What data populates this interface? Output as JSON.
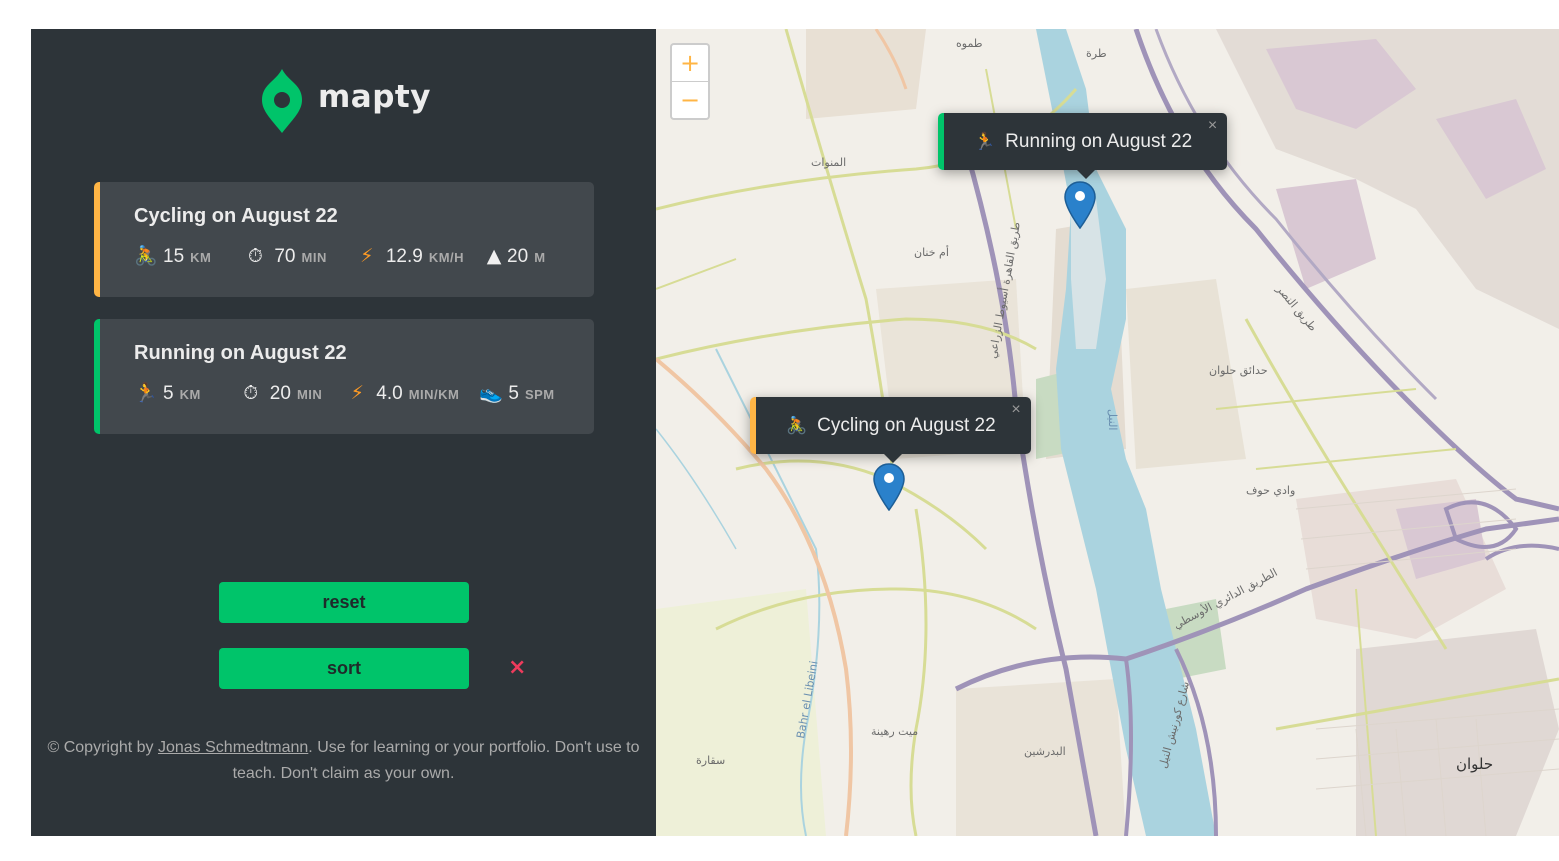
{
  "brand": {
    "name": "mapty",
    "logo_color": "#00c46a"
  },
  "colors": {
    "sidebar_bg": "#2d3439",
    "card_bg": "#42484d",
    "cycling_accent": "#ffb545",
    "running_accent": "#00c46a",
    "button_bg": "#00c46a",
    "close_x": "#ee3b5c"
  },
  "workouts": [
    {
      "type": "cycling",
      "title": "Cycling on August 22",
      "details": [
        {
          "icon": "cyclist-icon",
          "glyph": "🚴",
          "value": "15",
          "unit": "km"
        },
        {
          "icon": "stopwatch-icon",
          "glyph": "⏱",
          "value": "70",
          "unit": "min"
        },
        {
          "icon": "lightning-icon",
          "glyph": "⚡",
          "value": "12.9",
          "unit": "km/h"
        },
        {
          "icon": "mountain-icon",
          "glyph": "▲",
          "value": "20",
          "unit": "m"
        }
      ]
    },
    {
      "type": "running",
      "title": "Running on August 22",
      "details": [
        {
          "icon": "runner-icon",
          "glyph": "🏃",
          "value": "5",
          "unit": "km"
        },
        {
          "icon": "stopwatch-icon",
          "glyph": "⏱",
          "value": "20",
          "unit": "min"
        },
        {
          "icon": "lightning-icon",
          "glyph": "⚡",
          "value": "4.0",
          "unit": "min/km"
        },
        {
          "icon": "shoe-icon",
          "glyph": "👟",
          "value": "5",
          "unit": "spm"
        }
      ]
    }
  ],
  "buttons": {
    "reset": "reset",
    "sort": "sort",
    "close": "×"
  },
  "footer": {
    "prefix": "© Copyright by ",
    "author": "Jonas Schmedtmann",
    "suffix": ". Use for learning or your portfolio. Don't use to teach. Don't claim as your own."
  },
  "map": {
    "zoom_in": "+",
    "zoom_out": "−",
    "popups": [
      {
        "type": "running",
        "icon_glyph": "🏃",
        "label": "Running on August 22",
        "close": "×"
      },
      {
        "type": "cycling",
        "icon_glyph": "🚴",
        "label": "Cycling on August 22",
        "close": "×"
      }
    ],
    "place_labels": [
      "طموه",
      "طرة",
      "المنوات",
      "أم خنان",
      "حدائق حلوان",
      "وادي حوف",
      "الطريق الدائري الأوسطي",
      "طريق النصر",
      "Bahr el Libeini",
      "ميت رهينة",
      "البدرشين",
      "سقارة",
      "حلوان",
      "النيل",
      "طريق القاهرة أسيوط الزراعي",
      "شارع كورنيش النيل"
    ]
  }
}
